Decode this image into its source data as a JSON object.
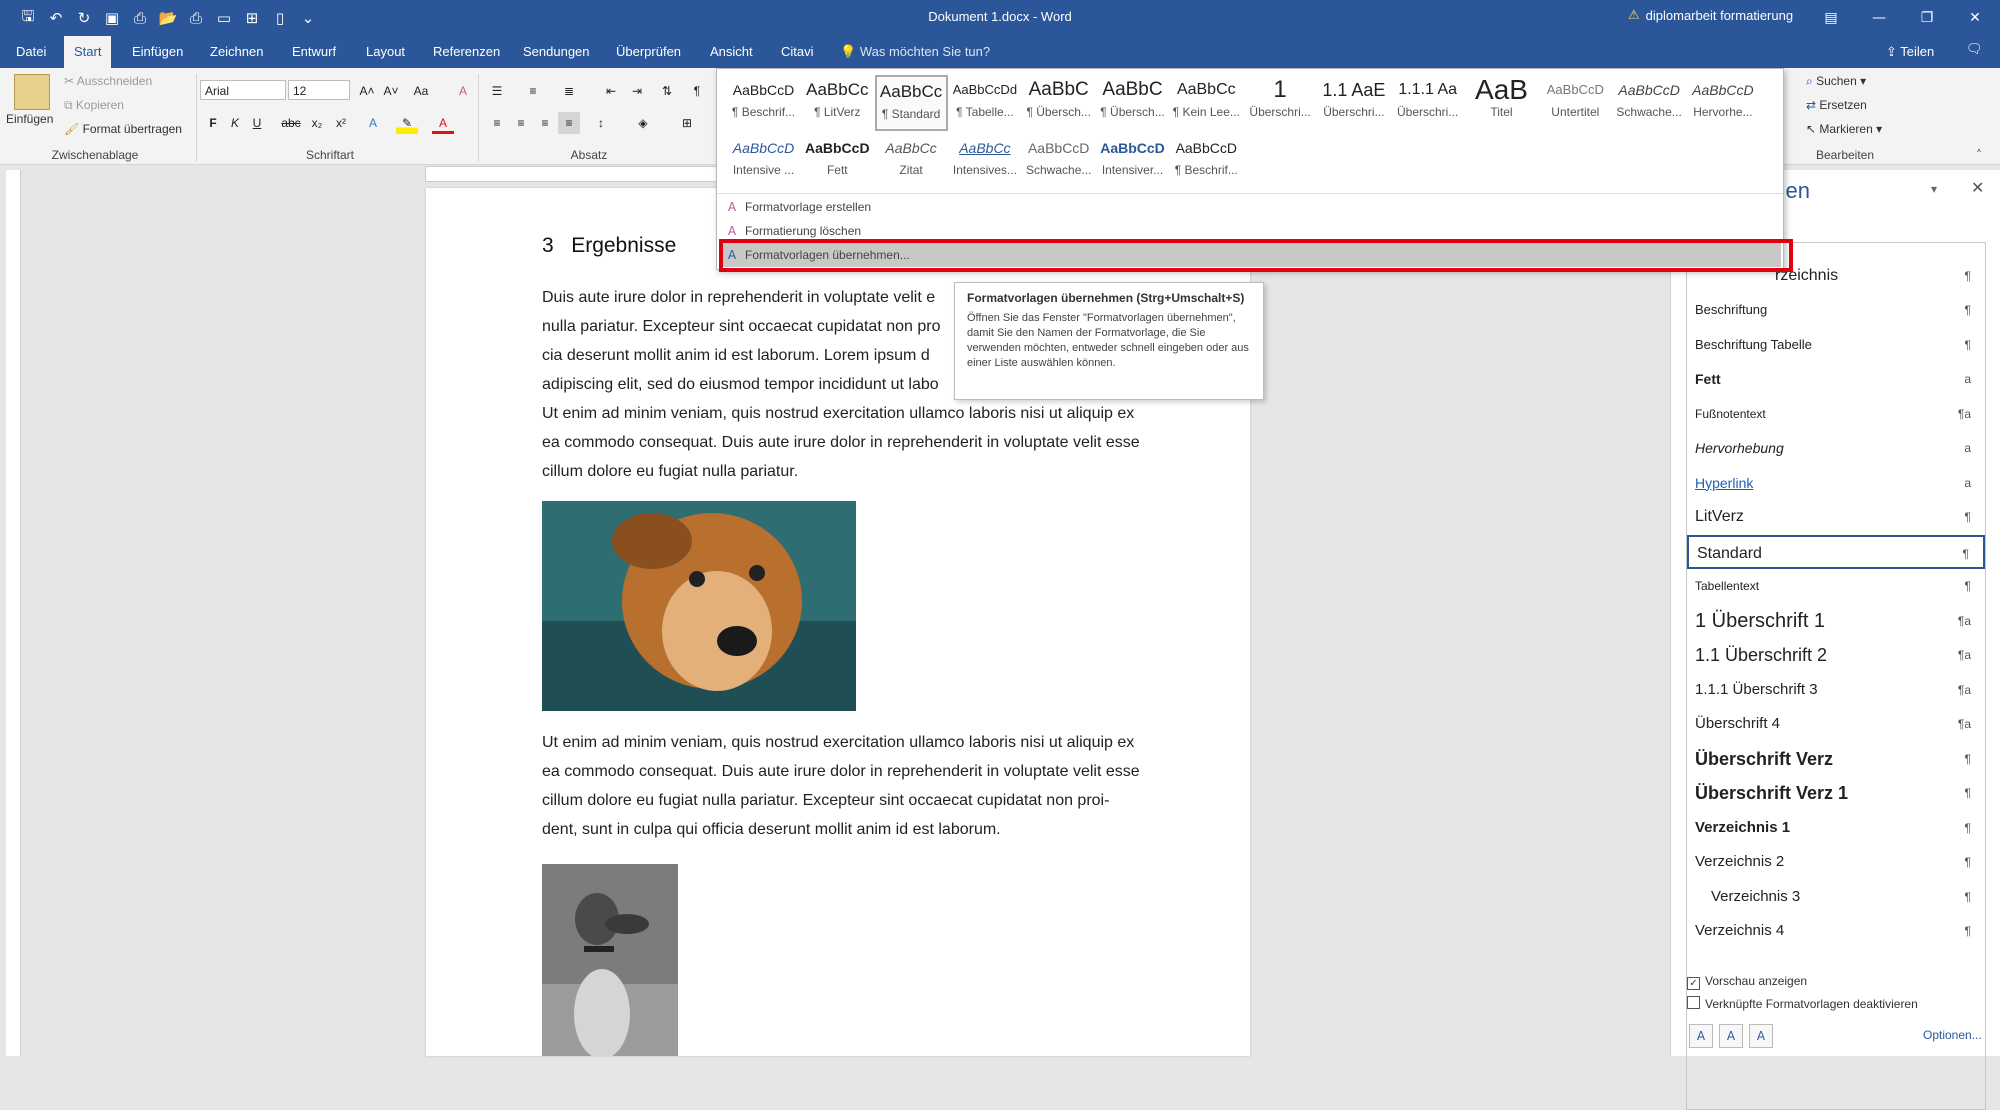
{
  "window": {
    "title": "Dokument 1.docx  -  Word",
    "account_warning": "diplomarbeit formatierung",
    "qat_icons": [
      "save-icon",
      "undo-icon",
      "redo-icon",
      "save-as-icon",
      "print-preview-icon",
      "open-icon",
      "print-icon",
      "layout-icon",
      "table-icon",
      "new-doc-icon",
      "customize-icon"
    ]
  },
  "tabs": [
    {
      "label": "Datei"
    },
    {
      "label": "Start",
      "active": true
    },
    {
      "label": "Einfügen"
    },
    {
      "label": "Zeichnen"
    },
    {
      "label": "Entwurf"
    },
    {
      "label": "Layout"
    },
    {
      "label": "Referenzen"
    },
    {
      "label": "Sendungen"
    },
    {
      "label": "Überprüfen"
    },
    {
      "label": "Ansicht"
    },
    {
      "label": "Citavi"
    }
  ],
  "tell_me": "Was möchten Sie tun?",
  "share": "Teilen",
  "ribbon": {
    "clipboard": {
      "label": "Zwischenablage",
      "paste": "Einfügen",
      "cut": "Ausschneiden",
      "copy": "Kopieren",
      "format_painter": "Format übertragen"
    },
    "font": {
      "label": "Schriftart",
      "name": "Arial",
      "size": "12",
      "bold": "F",
      "italic": "K",
      "underline": "U",
      "strike": "abc",
      "sub": "x₂",
      "sup": "x²"
    },
    "paragraph": {
      "label": "Absatz"
    },
    "editing": {
      "label": "Bearbeiten",
      "find": "Suchen",
      "replace": "Ersetzen",
      "select": "Markieren"
    }
  },
  "gallery": {
    "row1": [
      {
        "preview": "AaBbCcD",
        "name": "¶ Beschrif..."
      },
      {
        "preview": "AaBbCc",
        "name": "¶ LitVerz"
      },
      {
        "preview": "AaBbCc",
        "name": "¶ Standard",
        "selected": true
      },
      {
        "preview": "AaBbCcDd",
        "name": "¶ Tabelle..."
      },
      {
        "preview": "AaBbC",
        "name": "¶ Übersch..."
      },
      {
        "preview": "AaBbC",
        "name": "¶ Übersch..."
      },
      {
        "preview": "AaBbCc",
        "name": "¶ Kein Lee..."
      },
      {
        "preview": "1",
        "name": "Überschri..."
      },
      {
        "preview": "1.1 AaE",
        "name": "Überschri..."
      },
      {
        "preview": "1.1.1 Aa",
        "name": "Überschri..."
      },
      {
        "preview": "AaB",
        "name": "Titel"
      },
      {
        "preview": "AaBbCcD",
        "name": "Untertitel"
      },
      {
        "preview": "AaBbCcD",
        "name": "Schwache..."
      },
      {
        "preview": "AaBbCcD",
        "name": "Hervorhe..."
      }
    ],
    "row2": [
      {
        "preview": "AaBbCcD",
        "name": "Intensive ..."
      },
      {
        "preview": "AaBbCcD",
        "name": "Fett"
      },
      {
        "preview": "AaBbCc",
        "name": "Zitat"
      },
      {
        "preview": "AaBbCc",
        "name": "Intensives..."
      },
      {
        "preview": "AaBbCcD",
        "name": "Schwache..."
      },
      {
        "preview": "AaBbCcD",
        "name": "Intensiver..."
      },
      {
        "preview": "AaBbCcD",
        "name": "¶ Beschrif..."
      }
    ],
    "menu": {
      "create": "Formatvorlage erstellen",
      "clear": "Formatierung löschen",
      "apply": "Formatvorlagen übernehmen..."
    }
  },
  "tooltip": {
    "title": "Formatvorlagen übernehmen (Strg+Umschalt+S)",
    "body": "Öffnen Sie das Fenster \"Formatvorlagen übernehmen\", damit Sie den Namen der Formatvorlage, die Sie verwenden möchten, entweder schnell eingeben oder aus einer Liste auswählen können."
  },
  "document": {
    "heading_number": "3",
    "heading_text": "Ergebnisse",
    "para1_lines": [
      "Duis aute irure dolor in reprehenderit in voluptate velit e",
      "nulla pariatur. Excepteur sint occaecat cupidatat non pro",
      "cia deserunt mollit anim id est laborum. Lorem ipsum d",
      "adipiscing elit, sed do eiusmod tempor incididunt ut labo",
      "Ut enim ad minim veniam, quis nostrud exercitation ullamco laboris nisi ut aliquip ex",
      "ea commodo consequat. Duis aute irure dolor in reprehenderit in voluptate velit esse",
      "cillum dolore eu fugiat nulla pariatur."
    ],
    "para2_lines": [
      "Ut enim ad minim veniam, quis nostrud exercitation ullamco laboris nisi ut aliquip ex",
      "ea commodo consequat. Duis aute irure dolor in reprehenderit in voluptate velit esse",
      "cillum dolore eu fugiat nulla pariatur. Excepteur sint occaecat cupidatat non proi-",
      "dent, sunt in culpa qui officia deserunt mollit anim id est laborum."
    ]
  },
  "styles_pane": {
    "title": "agen",
    "first_item_partial": "rzeichnis",
    "items": [
      {
        "label": "Beschriftung",
        "mark": "¶",
        "font": "13px"
      },
      {
        "label": "Beschriftung Tabelle",
        "mark": "¶",
        "font": "13px"
      },
      {
        "label": "Fett",
        "mark": "a",
        "font": "14px",
        "weight": "bold"
      },
      {
        "label": "Fußnotentext",
        "mark": "¶a",
        "font": "12px"
      },
      {
        "label": "Hervorhebung",
        "mark": "a",
        "font": "14px",
        "style": "italic"
      },
      {
        "label": "Hyperlink",
        "mark": "a",
        "font": "14px",
        "color": "#1f5fb4",
        "underline": true
      },
      {
        "label": "LitVerz",
        "mark": "¶",
        "font": "16px"
      },
      {
        "label": "Standard",
        "mark": "¶",
        "font": "16px",
        "selected": true
      },
      {
        "label": "Tabellentext",
        "mark": "¶",
        "font": "12px"
      },
      {
        "label": "1  Überschrift 1",
        "mark": "¶a",
        "font": "20px"
      },
      {
        "label": "1.1  Überschrift 2",
        "mark": "¶a",
        "font": "18px"
      },
      {
        "label": "1.1.1  Überschrift 3",
        "mark": "¶a",
        "font": "15px"
      },
      {
        "label": "Überschrift 4",
        "mark": "¶a",
        "font": "15px"
      },
      {
        "label": "Überschrift Verz",
        "mark": "¶",
        "font": "18px",
        "weight": "bold"
      },
      {
        "label": "Überschrift Verz 1",
        "mark": "¶",
        "font": "18px",
        "weight": "bold"
      },
      {
        "label": "Verzeichnis 1",
        "mark": "¶",
        "font": "15px",
        "weight": "bold"
      },
      {
        "label": "Verzeichnis 2",
        "mark": "¶",
        "font": "15px"
      },
      {
        "label": "Verzeichnis 3",
        "mark": "¶",
        "font": "15px",
        "indent": true
      },
      {
        "label": "Verzeichnis 4",
        "mark": "¶",
        "font": "15px"
      }
    ],
    "show_preview": "Vorschau anzeigen",
    "disable_linked": "Verknüpfte Formatvorlagen deaktivieren",
    "options": "Optionen..."
  }
}
